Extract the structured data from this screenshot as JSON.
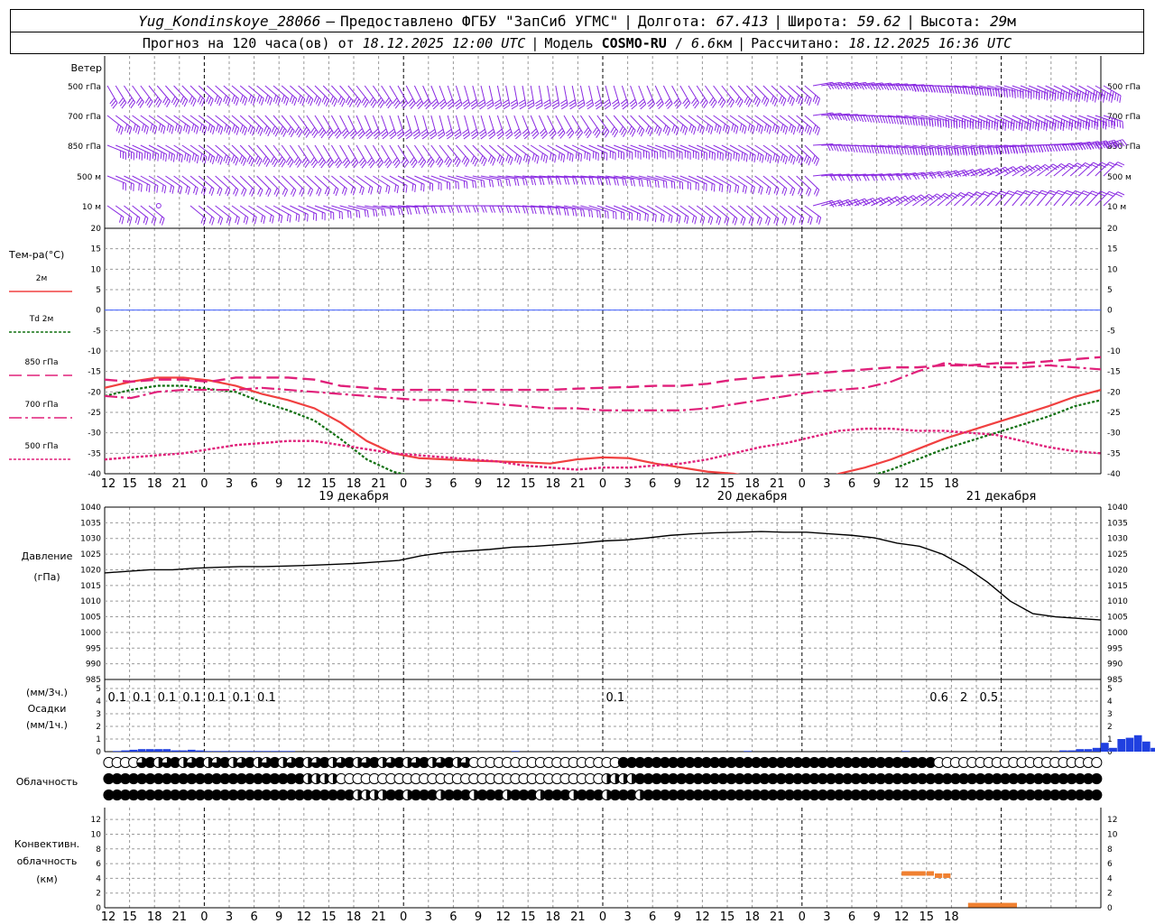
{
  "header": {
    "station": "Yug_Kondinskoye_28066",
    "dash": "–",
    "provided_by": "Предоставлено ФГБУ \"ЗапСиб УГМС\"",
    "lon_label": "Долгота:",
    "lon_value": "67.413",
    "lat_label": "Широта:",
    "lat_value": "59.62",
    "alt_label": "Высота:",
    "alt_value": "29",
    "alt_unit": "м",
    "forecast_label": "Прогноз на 120 часа(ов) от",
    "forecast_start": "18.12.2025 12:00 UTC",
    "model_label": "Модель",
    "model_name": "COSMO-RU",
    "model_res": "6.6",
    "model_res_unit": "км",
    "calc_label": "Рассчитано:",
    "calc_time": "18.12.2025 16:36 UTC"
  },
  "colors": {
    "wind": "#8a2be2",
    "t2m": "#f04040",
    "td2m": "#107010",
    "t850": "#e0207a",
    "t700": "#e0207a",
    "t500": "#e0207a",
    "zero_line": "#4060ff",
    "precip": "#2040e0",
    "conv": "#f08030",
    "grid": "#999999"
  },
  "wind_panel": {
    "title": "Ветер",
    "levels": [
      "500 гПа",
      "700 гПа",
      "850 гПа",
      "500 м",
      "10 м"
    ]
  },
  "temp_panel": {
    "title": "Тем-ра(°C)",
    "legend": [
      {
        "label": "2м",
        "key": "t2m"
      },
      {
        "label": "Td 2м",
        "key": "td2m"
      },
      {
        "label": "850 гПа",
        "key": "t850"
      },
      {
        "label": "700 гПа",
        "key": "t700"
      },
      {
        "label": "500 гПа",
        "key": "t500"
      }
    ]
  },
  "pressure_panel": {
    "title": "Давление",
    "unit": "(гПа)"
  },
  "precip_panel": {
    "unit_top": "(мм/3ч.)",
    "title": "Осадки",
    "unit_bottom": "(мм/1ч.)"
  },
  "cloud_panel": {
    "title": "Облачность"
  },
  "conv_panel": {
    "title_1": "Конвективн.",
    "title_2": "облачность",
    "unit": "(км)"
  },
  "chart_data": [
    {
      "type": "line",
      "title": "Тем-ра(°C)",
      "x_hours": [
        0,
        3,
        6,
        9,
        12,
        15,
        18,
        21,
        24,
        27,
        30,
        33,
        36,
        39,
        42,
        45,
        48,
        51,
        54,
        57,
        60,
        63,
        66,
        69,
        72,
        75,
        78,
        81,
        84,
        87,
        90,
        93,
        96,
        99,
        102,
        105,
        108,
        111,
        114,
        117,
        120
      ],
      "x_tick_labels": [
        "12",
        "15",
        "18",
        "21",
        "0",
        "3",
        "6",
        "9",
        "12",
        "15",
        "18",
        "21",
        "0",
        "3",
        "6",
        "9",
        "12",
        "15",
        "18",
        "21",
        "0",
        "3",
        "6",
        "9",
        "12",
        "15",
        "18",
        "21",
        "0",
        "3",
        "6",
        "9",
        "12",
        "15",
        "18"
      ],
      "day_labels": [
        "19 декабря",
        "20 декабря",
        "21 декабря"
      ],
      "ylim": [
        -40,
        20
      ],
      "y_ticks": [
        20,
        15,
        10,
        5,
        0,
        -5,
        -10,
        -15,
        -20,
        -25,
        -30,
        -35,
        -40
      ],
      "series": [
        {
          "name": "2м",
          "key": "t2m",
          "values": [
            -19,
            -17.5,
            -16.5,
            -16.5,
            -17.2,
            -18.5,
            -20.5,
            -22,
            -24,
            -27.5,
            -32,
            -35,
            -36.2,
            -36.5,
            -36.8,
            -37,
            -37.2,
            -37.5,
            -36.5,
            -36,
            -36.2,
            -37.5,
            -38.5,
            -39.5,
            -40,
            -41,
            -42,
            -42.5,
            -40,
            -38.5,
            -36.5,
            -34,
            -31.5,
            -29.5,
            -27.5,
            -25.5,
            -23.5,
            -21.2,
            -19.5
          ]
        },
        {
          "name": "Td 2м",
          "key": "td2m",
          "values": [
            -21,
            -19.5,
            -18.5,
            -18.5,
            -19.3,
            -20,
            -22.5,
            -24.5,
            -27,
            -31.5,
            -36.5,
            -39.5,
            -41,
            -42,
            -43,
            -43.5,
            -44,
            -44,
            -42.5,
            -41.5,
            -41.5,
            -43,
            -44,
            -45,
            -45.5,
            -46,
            -46,
            -45,
            -43,
            -41,
            -39,
            -36.5,
            -34,
            -32,
            -30,
            -28,
            -26,
            -23.5,
            -22
          ]
        },
        {
          "name": "850 гПа",
          "key": "t850",
          "values": [
            -17,
            -17.5,
            -17,
            -17,
            -17.5,
            -16.5,
            -16.5,
            -16.5,
            -17,
            -18.5,
            -19,
            -19.5,
            -19.5,
            -19.5,
            -19.5,
            -19.5,
            -19.5,
            -19.5,
            -19.2,
            -19,
            -18.8,
            -18.5,
            -18.5,
            -18,
            -17,
            -16.5,
            -16,
            -15.5,
            -15,
            -14.5,
            -14,
            -14,
            -13.5,
            -13.5,
            -13,
            -13,
            -12.5,
            -12,
            -11.5
          ]
        },
        {
          "name": "700 гПа",
          "key": "t700",
          "values": [
            -21,
            -21.5,
            -20,
            -19.5,
            -19.5,
            -19.5,
            -19,
            -19.5,
            -20,
            -20.5,
            -21,
            -21.5,
            -22,
            -22,
            -22.5,
            -23,
            -23.5,
            -24,
            -24,
            -24.5,
            -24.5,
            -24.5,
            -24.5,
            -24,
            -23,
            -22,
            -21,
            -20,
            -19.5,
            -19,
            -17.5,
            -15,
            -13,
            -13.5,
            -14,
            -14,
            -13.5,
            -14,
            -14.5
          ]
        },
        {
          "name": "500 гПа",
          "key": "t500",
          "values": [
            -36.5,
            -36,
            -35.5,
            -35,
            -34,
            -33,
            -32.5,
            -32,
            -32,
            -33,
            -34,
            -35,
            -35.5,
            -36,
            -36.5,
            -37,
            -38,
            -38.5,
            -39,
            -38.5,
            -38.5,
            -38,
            -37.5,
            -36.5,
            -35,
            -33.5,
            -32.5,
            -31,
            -29.5,
            -29,
            -29,
            -29.5,
            -29.5,
            -30,
            -30.5,
            -32,
            -33.5,
            -34.5,
            -35
          ]
        }
      ]
    },
    {
      "type": "line",
      "title": "Давление",
      "ylabel": "(гПа)",
      "ylim": [
        985,
        1040
      ],
      "y_ticks": [
        1040,
        1035,
        1030,
        1025,
        1020,
        1015,
        1010,
        1005,
        1000,
        995,
        990,
        985
      ],
      "x_hours": [
        0,
        3,
        6,
        9,
        12,
        15,
        18,
        21,
        24,
        27,
        30,
        33,
        36,
        39,
        42,
        45,
        48,
        51,
        54,
        57,
        60,
        63,
        66,
        69,
        72,
        75,
        78,
        81,
        84,
        87,
        90,
        93,
        96,
        99,
        102,
        105,
        108,
        111,
        114,
        117,
        120
      ],
      "series": [
        {
          "name": "Давление",
          "values": [
            1019,
            1019.5,
            1020,
            1020,
            1020.5,
            1020.8,
            1021,
            1021,
            1021.2,
            1021.4,
            1021.7,
            1022,
            1022.5,
            1023,
            1024.5,
            1025.5,
            1026,
            1026.5,
            1027.2,
            1027.5,
            1028,
            1028.5,
            1029.2,
            1029.5,
            1030.2,
            1031,
            1031.5,
            1031.8,
            1032,
            1032.2,
            1032,
            1032,
            1031.5,
            1031,
            1030.2,
            1028.5,
            1027.5,
            1025,
            1021,
            1016,
            1010,
            1006,
            1005,
            1004.5,
            1004
          ]
        }
      ]
    },
    {
      "type": "bar",
      "title": "Осадки",
      "ylabel": "(мм/1ч.)",
      "ylim": [
        0,
        5
      ],
      "y_ticks": [
        5,
        4,
        3,
        2,
        1,
        0
      ],
      "labels_3h": [
        {
          "hour": 1.5,
          "value": "0.1"
        },
        {
          "hour": 4.5,
          "value": "0.1"
        },
        {
          "hour": 7.5,
          "value": "0.1"
        },
        {
          "hour": 10.5,
          "value": "0.1"
        },
        {
          "hour": 13.5,
          "value": "0.1"
        },
        {
          "hour": 16.5,
          "value": "0.1"
        },
        {
          "hour": 19.5,
          "value": "0.1"
        },
        {
          "hour": 61.5,
          "value": "0.1"
        },
        {
          "hour": 100.5,
          "value": "0.6"
        },
        {
          "hour": 103.5,
          "value": "2"
        },
        {
          "hour": 106.5,
          "value": "0.5"
        }
      ],
      "values_1h": [
        0,
        0.05,
        0.1,
        0.15,
        0.2,
        0.2,
        0.2,
        0.2,
        0.1,
        0.1,
        0.15,
        0.1,
        0.05,
        0.05,
        0.05,
        0.05,
        0.05,
        0.05,
        0.05,
        0.05,
        0.05,
        0.05,
        0.05,
        0,
        0,
        0,
        0,
        0,
        0,
        0,
        0,
        0,
        0,
        0,
        0,
        0,
        0,
        0,
        0,
        0,
        0,
        0,
        0,
        0,
        0,
        0,
        0,
        0,
        0,
        0.05,
        0,
        0,
        0,
        0,
        0,
        0,
        0,
        0,
        0,
        0,
        0,
        0,
        0,
        0,
        0,
        0,
        0,
        0,
        0,
        0,
        0,
        0,
        0,
        0,
        0,
        0,
        0,
        0.05,
        0,
        0,
        0,
        0,
        0,
        0,
        0,
        0,
        0,
        0,
        0,
        0,
        0,
        0,
        0,
        0,
        0,
        0,
        0.05,
        0,
        0,
        0,
        0,
        0,
        0,
        0,
        0,
        0,
        0,
        0,
        0,
        0,
        0,
        0,
        0,
        0,
        0,
        0.1,
        0.1,
        0.2,
        0.2,
        0.3,
        0.7,
        0.3,
        1.0,
        1.1,
        1.3,
        0.8,
        0.3,
        0.3,
        0.2,
        0.3,
        0.2,
        0.1
      ]
    },
    {
      "type": "table",
      "title": "Облачность",
      "rows": 3
    },
    {
      "type": "bar",
      "title": "Конвективн. облачность",
      "ylabel": "(км)",
      "ylim": [
        0,
        13
      ],
      "y_ticks": [
        12,
        10,
        8,
        6,
        4,
        2,
        0
      ],
      "segments": [
        {
          "from": 96,
          "to": 99,
          "value": 4.6
        },
        {
          "from": 99,
          "to": 100,
          "value": 4.6
        },
        {
          "from": 100,
          "to": 101,
          "value": 4.3
        },
        {
          "from": 101,
          "to": 102,
          "value": 4.3
        },
        {
          "from": 104,
          "to": 110,
          "value": 0.3
        }
      ]
    }
  ]
}
